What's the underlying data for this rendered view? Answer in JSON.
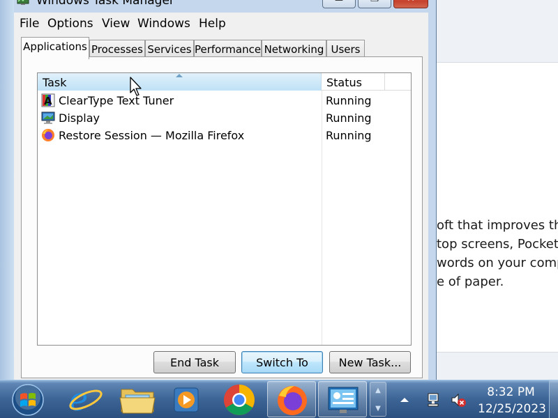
{
  "window": {
    "title": "Windows Task Manager",
    "minimize_icon": "minimize-icon",
    "maximize_icon": "maximize-icon",
    "close_icon": "close-icon"
  },
  "menu": [
    "File",
    "Options",
    "View",
    "Windows",
    "Help"
  ],
  "tabs": [
    {
      "label": "Applications",
      "active": true
    },
    {
      "label": "Processes",
      "active": false
    },
    {
      "label": "Services",
      "active": false
    },
    {
      "label": "Performance",
      "active": false
    },
    {
      "label": "Networking",
      "active": false
    },
    {
      "label": "Users",
      "active": false
    }
  ],
  "list": {
    "columns": {
      "task": "Task",
      "status": "Status"
    },
    "rows": [
      {
        "name": "ClearType Text Tuner",
        "status": "Running",
        "icon": "cleartype-icon"
      },
      {
        "name": "Display",
        "status": "Running",
        "icon": "display-icon"
      },
      {
        "name": "Restore Session — Mozilla Firefox",
        "status": "Running",
        "icon": "firefox-icon"
      }
    ]
  },
  "buttons": {
    "end_task": "End Task",
    "switch_to": "Switch To",
    "new_task": "New Task..."
  },
  "background_window": {
    "lines": [
      "oft that improves the",
      "top screens, Pocket",
      "words on your comp",
      "e of paper."
    ]
  },
  "taskbar": {
    "pinned": [
      "start-orb-icon",
      "internet-explorer-icon",
      "windows-explorer-icon",
      "media-player-icon",
      "chrome-icon",
      "firefox-icon",
      "control-panel-icon"
    ],
    "tray": [
      "show-hidden-icons-icon",
      "network-icon",
      "volume-muted-icon"
    ],
    "time": "8:32 PM",
    "date": "12/25/2023"
  },
  "colors": {
    "taskbar": "#3c6495",
    "header_highlight": "#bfe1f6",
    "close_button": "#c5412b"
  }
}
